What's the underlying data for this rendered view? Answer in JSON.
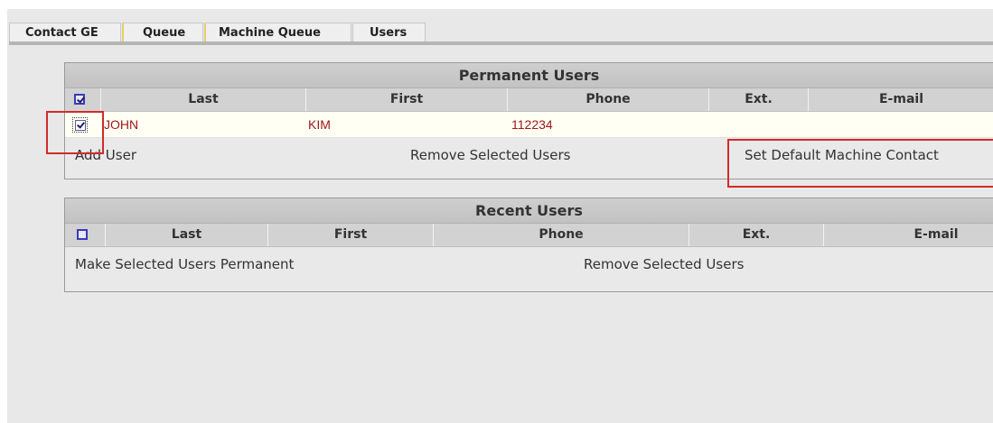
{
  "tabs": [
    "Contact GE",
    "Queue",
    "Machine Queue",
    "Users"
  ],
  "permanent_users": {
    "title": "Permanent Users",
    "select_all_checked": true,
    "columns": [
      "Last",
      "First",
      "Phone",
      "Ext.",
      "E-mail"
    ],
    "rows": [
      {
        "checked": true,
        "last": "JOHN",
        "first": "KIM",
        "phone": "112234",
        "ext": "",
        "email": ""
      }
    ],
    "actions": {
      "add": "Add User",
      "remove": "Remove Selected Users",
      "set_default": "Set Default Machine Contact"
    }
  },
  "recent_users": {
    "title": "Recent Users",
    "select_all_checked": false,
    "columns": [
      "Last",
      "First",
      "Phone",
      "Ext.",
      "E-mail"
    ],
    "actions": {
      "make_permanent": "Make Selected Users Permanent",
      "remove": "Remove Selected Users"
    }
  },
  "colors": {
    "highlight_box": "#d22a2a",
    "row_text": "#a01818",
    "checkbox": "#3b3bb5"
  }
}
